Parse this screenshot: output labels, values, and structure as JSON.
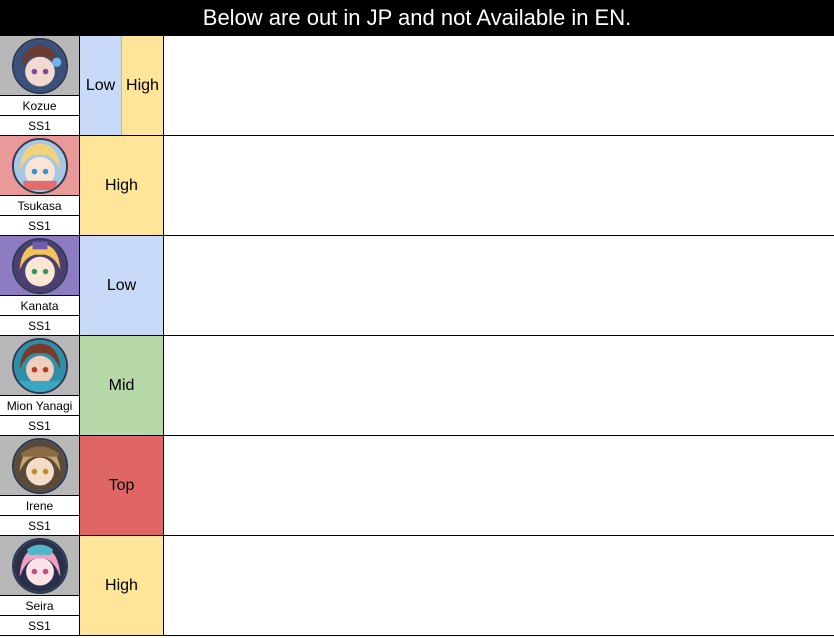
{
  "header": {
    "title": "Below are out in JP and not Available in EN."
  },
  "colors": {
    "low": "#c9daf8",
    "mid": "#b6d7a8",
    "high": "#ffe599",
    "top": "#e06666"
  },
  "characters": [
    {
      "name": "Kozue",
      "tier": "SS1",
      "portrait_bg": "#b8b8b8",
      "ratings": [
        "Low",
        "High"
      ],
      "rating_colors": [
        "#c9daf8",
        "#ffe599"
      ]
    },
    {
      "name": "Tsukasa",
      "tier": "SS1",
      "portrait_bg": "#ea9999",
      "ratings": [
        "High"
      ],
      "rating_colors": [
        "#ffe599"
      ]
    },
    {
      "name": "Kanata",
      "tier": "SS1",
      "portrait_bg": "#8e7cc3",
      "ratings": [
        "Low"
      ],
      "rating_colors": [
        "#c9daf8"
      ]
    },
    {
      "name": "Mion Yanagi",
      "tier": "SS1",
      "portrait_bg": "#b8b8b8",
      "ratings": [
        "Mid"
      ],
      "rating_colors": [
        "#b6d7a8"
      ]
    },
    {
      "name": "Irene",
      "tier": "SS1",
      "portrait_bg": "#b8b8b8",
      "ratings": [
        "Top"
      ],
      "rating_colors": [
        "#e06666"
      ]
    },
    {
      "name": "Seira",
      "tier": "SS1",
      "portrait_bg": "#b8b8b8",
      "ratings": [
        "High"
      ],
      "rating_colors": [
        "#ffe599"
      ]
    }
  ]
}
